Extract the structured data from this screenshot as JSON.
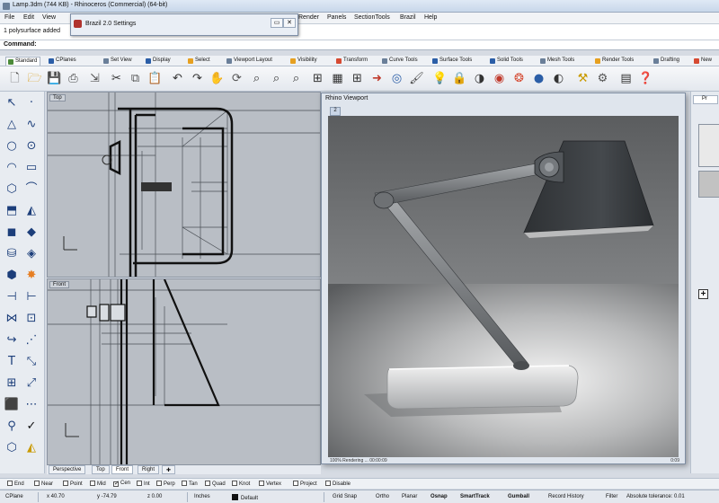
{
  "window": {
    "title": "Lamp.3dm (744 KB) - Rhinoceros (Commercial) (64-bit)"
  },
  "menu": [
    "File",
    "Edit",
    "View",
    "Render",
    "Panels",
    "SectionTools",
    "Brazil",
    "Help"
  ],
  "command_history": "1 polysurface added",
  "command_prompt": "Command:",
  "dialog": {
    "title": "Brazil 2.0 Settings"
  },
  "toolbar_tabs": [
    "Standard",
    "CPlanes",
    "Set View",
    "Display",
    "Select",
    "Viewport Layout",
    "Visibility",
    "Transform",
    "Curve Tools",
    "Surface Tools",
    "Solid Tools",
    "Mesh Tools",
    "Render Tools",
    "Drafting",
    "New"
  ],
  "toolbar_icons": [
    "new-file-icon",
    "open-icon",
    "save-icon",
    "print-icon",
    "import-icon",
    "cut-icon",
    "copy-icon",
    "paste-icon",
    "undo-icon",
    "redo-icon",
    "pan-icon",
    "rotate-icon",
    "zoom-icon",
    "zoom-window-icon",
    "zoom-extents-icon",
    "zoom-selected-icon",
    "four-viewports-icon",
    "grid-icon",
    "move-icon",
    "rotate-view-icon",
    "paint-icon",
    "lightbulb-icon",
    "lock-icon",
    "shade-icon",
    "material-icon",
    "color-wheel-icon",
    "sphere-icon",
    "render-icon",
    "tools-icon",
    "options-icon",
    "help-icon"
  ],
  "viewports": {
    "top_label": "Top",
    "front_label": "Front",
    "tabs": [
      "Perspective",
      "Top",
      "Front",
      "Right"
    ],
    "active_tab": "Front"
  },
  "render_viewport": {
    "title": "Rhino Viewport",
    "number": "2",
    "status": "100% Rendering ...  00:00:09",
    "zoom": "0:09"
  },
  "right_panel": {
    "tab": "Pr"
  },
  "osnap": {
    "items": [
      {
        "label": "End",
        "checked": false
      },
      {
        "label": "Near",
        "checked": false
      },
      {
        "label": "Point",
        "checked": false
      },
      {
        "label": "Mid",
        "checked": false
      },
      {
        "label": "Cen",
        "checked": true
      },
      {
        "label": "Int",
        "checked": false
      },
      {
        "label": "Perp",
        "checked": false
      },
      {
        "label": "Tan",
        "checked": false
      },
      {
        "label": "Quad",
        "checked": false
      },
      {
        "label": "Knot",
        "checked": false
      },
      {
        "label": "Vertex",
        "checked": false
      },
      {
        "label": "Project",
        "checked": false
      },
      {
        "label": "Disable",
        "checked": false
      }
    ]
  },
  "status_bar": {
    "cplane": "CPlane",
    "x": "x 40.70",
    "y": "y -74.79",
    "z": "z 0.00",
    "units": "Inches",
    "layer": "Default",
    "grid_snap": "Grid Snap",
    "ortho": "Ortho",
    "planar": "Planar",
    "osnap": "Osnap",
    "smarttrack": "SmartTrack",
    "gumball": "Gumball",
    "record_history": "Record History",
    "filter": "Filter",
    "tolerance": "Absolute tolerance: 0.01"
  },
  "colors": {
    "accent": "#2b5ea7",
    "viewport_bg": "#b9bec5",
    "render_wall": "#6b6d6f",
    "lamp_shade": "#3a3d40"
  }
}
